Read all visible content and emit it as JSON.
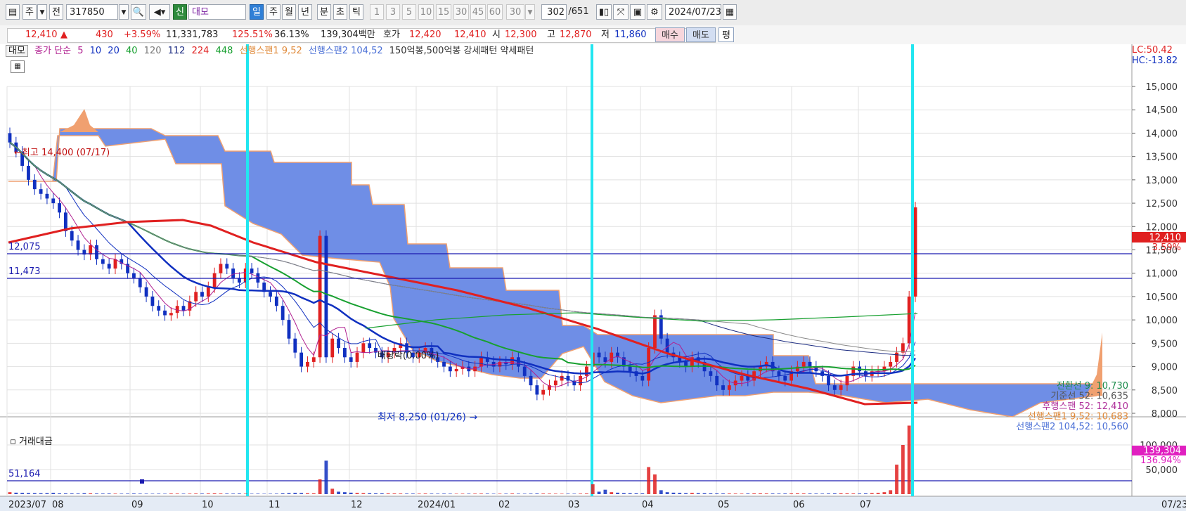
{
  "toolbar": {
    "type_label": "주",
    "market_label": "전",
    "code": "317850",
    "tag": "신",
    "stock_name": "대모",
    "periods": [
      "일",
      "주",
      "월",
      "년",
      "분",
      "초",
      "틱"
    ],
    "active_period": "일",
    "intervals": [
      "1",
      "3",
      "5",
      "10",
      "15",
      "30",
      "45",
      "60"
    ],
    "interval_value": "30",
    "count": "302",
    "total": "/651",
    "date": "2024/07/23"
  },
  "quote": {
    "price": "12,410",
    "arrow": "▲",
    "change": "430",
    "change_pct": "+3.59%",
    "volume": "11,331,783",
    "volume_ratio": "125.51%",
    "turnover": "36.13%",
    "amount": "139,304백만",
    "hoga_label": "호가",
    "ask": "12,420",
    "bid": "12,410",
    "open_label": "시",
    "open": "12,300",
    "high_label": "고",
    "high": "12,870",
    "low_label": "저",
    "low": "11,860",
    "buy_label": "매수",
    "sell_label": "매도",
    "avg_label": "평"
  },
  "legend": {
    "name": "대모",
    "ma_label": "종가 단순",
    "ma_periods": [
      "5",
      "10",
      "20",
      "40",
      "120",
      "112",
      "224",
      "448"
    ],
    "span1": "선행스팬1 9,52",
    "span2": "선행스팬2 104,52",
    "pattern": "150억봉,500억봉 강세패턴  약세패턴",
    "lc": "LC:50.42",
    "hc": "HC:-13.82"
  },
  "annotations": {
    "high_text": "←최고 14,400 (07/17)",
    "low_text": "최저 8,250 (01/26) →",
    "dividend_text": "배당락(0.00%)",
    "level1": "12,075",
    "level2": "11,473",
    "vol_level": "51,164"
  },
  "right_panel": {
    "price_tag": "12,410",
    "price_pct": "3.59%",
    "ichimoku": [
      {
        "text": "전환선 9: 10,730",
        "color": "#1a8a4a"
      },
      {
        "text": "기준선 52: 10,635",
        "color": "#555555"
      },
      {
        "text": "후행스팬 52: 12,410",
        "color": "#b0329b"
      },
      {
        "text": "선행스팬1 9,52: 10,683",
        "color": "#e08a3a"
      },
      {
        "text": "선행스팬2 104,52: 10,560",
        "color": "#4a6fd6"
      }
    ],
    "vol_tag": "139,304",
    "vol_pct": "136.94%"
  },
  "colors": {
    "up": "#e02020",
    "down": "#1030c0",
    "cloud": "#6f8ee6",
    "cloud_edge": "#f0a070",
    "cyan": "#22e6f0",
    "ma224": "#e02020",
    "ma120": "#18a030",
    "ma_blue": "#1030c0"
  },
  "chart_data": {
    "type": "candlestick",
    "title": "대모 (317850) 일봉",
    "y_axis": {
      "ticks": [
        8000,
        8500,
        9000,
        9500,
        10000,
        10500,
        11000,
        11500,
        12000,
        12500,
        13000,
        13500,
        14000,
        14500,
        15000
      ],
      "ylim": [
        8000,
        15000
      ]
    },
    "x_axis": {
      "labels": [
        "2023/07",
        "08",
        "09",
        "10",
        "11",
        "12",
        "2024/01",
        "02",
        "03",
        "04",
        "05",
        "06",
        "07",
        "07/23"
      ]
    },
    "volume_axis": {
      "ticks": [
        50000,
        100000
      ],
      "label": "거래대금"
    },
    "closes": [
      13800,
      13600,
      13300,
      13000,
      12800,
      12700,
      12600,
      12500,
      12300,
      11900,
      11700,
      11500,
      11400,
      11600,
      11300,
      11200,
      11100,
      11300,
      11200,
      11000,
      10900,
      10700,
      10500,
      10300,
      10200,
      10100,
      10150,
      10300,
      10200,
      10400,
      10600,
      10500,
      10700,
      11000,
      11200,
      11100,
      10900,
      10800,
      11100,
      11000,
      10800,
      10600,
      10500,
      10300,
      10000,
      9600,
      9300,
      9000,
      9100,
      9200,
      11800,
      9200,
      9600,
      9400,
      9200,
      9100,
      9300,
      9500,
      9400,
      9300,
      9200,
      9300,
      9400,
      9500,
      9300,
      9200,
      9300,
      9400,
      9200,
      9100,
      9000,
      8900,
      8950,
      9000,
      8900,
      9000,
      9200,
      9100,
      9000,
      9100,
      9050,
      9200,
      9000,
      8800,
      8600,
      8400,
      8500,
      8600,
      8700,
      8800,
      8700,
      8600,
      8800,
      9000,
      9300,
      9200,
      9100,
      9300,
      9200,
      9000,
      8900,
      8800,
      8700,
      9400,
      10100,
      9600,
      9300,
      9200,
      9100,
      9000,
      9200,
      9100,
      8900,
      8800,
      8600,
      8500,
      8600,
      8700,
      8800,
      8700,
      8900,
      9000,
      9100,
      8900,
      8800,
      8700,
      8900,
      9000,
      9100,
      9000,
      8900,
      8800,
      8600,
      8500,
      8600,
      8800,
      9000,
      8900,
      8800,
      8900,
      8900,
      9000,
      9100,
      9300,
      9500,
      10500,
      12410
    ],
    "volumes": [
      4000,
      3000,
      2500,
      2200,
      2000,
      1800,
      2000,
      2600,
      1500,
      1400,
      1300,
      1200,
      1800,
      1600,
      1200,
      1100,
      1200,
      1000,
      900,
      1000,
      1200,
      1000,
      900,
      800,
      900,
      800,
      1200,
      1100,
      900,
      1000,
      1200,
      1100,
      1300,
      1500,
      1200,
      1100,
      1000,
      1200,
      900,
      800,
      900,
      700,
      800,
      900,
      1500,
      2000,
      2500,
      2200,
      1800,
      1600,
      30000,
      68000,
      11000,
      5000,
      4000,
      3000,
      2500,
      2000,
      1800,
      1600,
      1500,
      1400,
      1300,
      1200,
      1100,
      1100,
      1000,
      1200,
      1000,
      900,
      1000,
      900,
      800,
      900,
      900,
      1000,
      1100,
      1000,
      800,
      900,
      900,
      1200,
      900,
      800,
      1000,
      1200,
      1100,
      1000,
      900,
      800,
      900,
      800,
      1000,
      1200,
      20000,
      5000,
      9000,
      4000,
      3000,
      2000,
      1800,
      1600,
      1500,
      55000,
      40000,
      8000,
      4000,
      3000,
      2500,
      2000,
      2500,
      2000,
      1800,
      1500,
      1400,
      1300,
      1200,
      1100,
      1000,
      1200,
      1400,
      1500,
      1300,
      1200,
      1100,
      1200,
      1400,
      1500,
      1300,
      1200,
      1100,
      1000,
      1200,
      1400,
      1600,
      1500,
      1300,
      1200,
      1400,
      2000,
      2500,
      4000,
      8000,
      60000,
      100000,
      139304
    ]
  }
}
